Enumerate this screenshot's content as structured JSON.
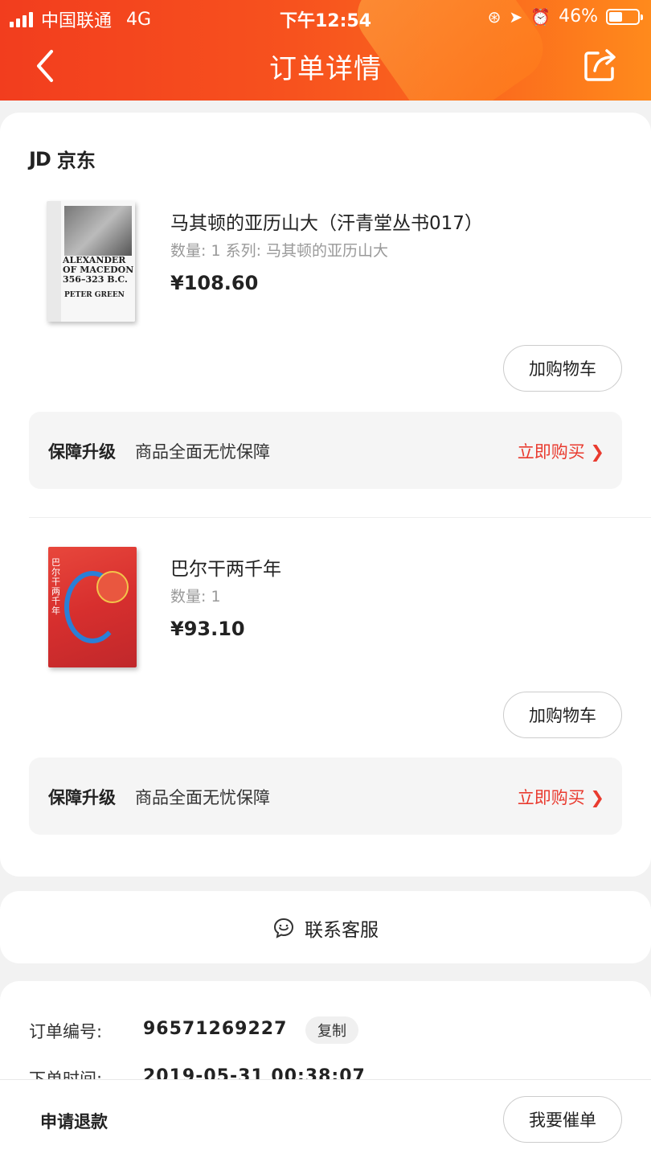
{
  "status_bar": {
    "carrier": "中国联通",
    "network": "4G",
    "time": "下午12:54",
    "battery": "46%",
    "battery_level": 0.46
  },
  "header": {
    "title": "订单详情",
    "back_icon": "chevron-left-icon",
    "share_icon": "share-icon"
  },
  "shop": {
    "logo": "JD",
    "name": "京东"
  },
  "products": [
    {
      "name": "马其顿的亚历山大（汗青堂丛书017）",
      "meta": "数量: 1  系列: 马其顿的亚历山大",
      "price": "¥108.60",
      "cover_title": "ALEXANDER OF MACEDON 356–323 B.C.",
      "cover_author": "PETER GREEN",
      "add_cart_label": "加购物车",
      "guarantee": {
        "key": "保障升级",
        "value": "商品全面无忧保障",
        "action": "立即购买 ❯"
      }
    },
    {
      "name": "巴尔干两千年",
      "meta": "数量: 1",
      "price": "¥93.10",
      "cover_title": "巴尔干两千年",
      "add_cart_label": "加购物车",
      "guarantee": {
        "key": "保障升级",
        "value": "商品全面无忧保障",
        "action": "立即购买 ❯"
      }
    }
  ],
  "customer_service": {
    "label": "联系客服",
    "icon": "chat-smile-icon"
  },
  "order_info": {
    "number_label": "订单编号:",
    "number_value": "96571269227",
    "copy_label": "复制",
    "time_label": "下单时间:",
    "time_value": "2019-05-31 00:38:07"
  },
  "bottom_bar": {
    "refund_label": "申请退款",
    "urge_label": "我要催单"
  },
  "colors": {
    "header": "#f7521e",
    "accent": "#e93b2f"
  }
}
